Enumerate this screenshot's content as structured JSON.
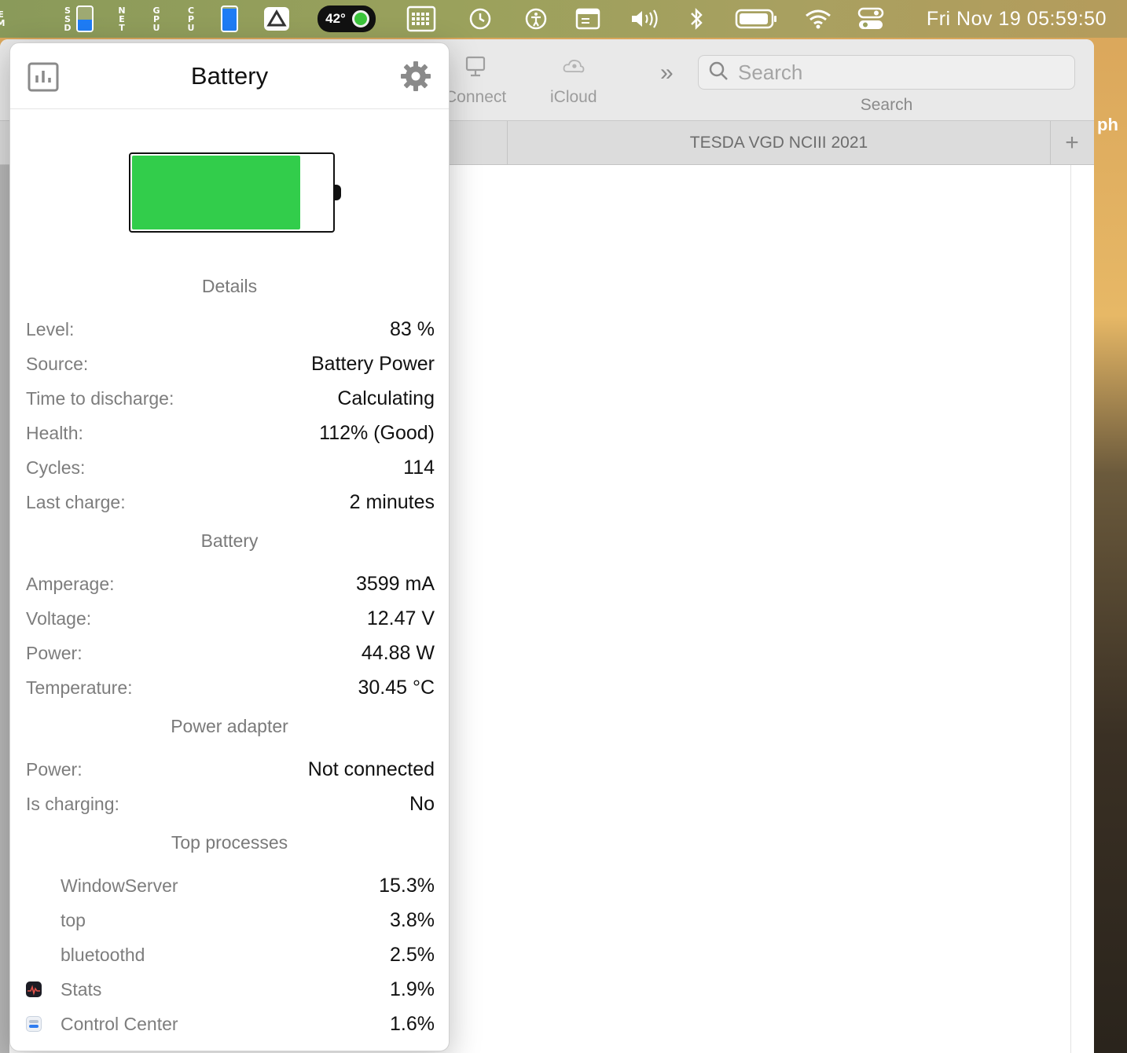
{
  "menubar": {
    "stack_labels": [
      {
        "name": "mem-stack",
        "text": "MEM"
      },
      {
        "name": "ssd-stack",
        "text": "SSD"
      },
      {
        "name": "net-stack",
        "text": "NET"
      },
      {
        "name": "gpu-stack",
        "text": "GPU"
      },
      {
        "name": "cpu-stack",
        "text": "CPU"
      }
    ],
    "temperature": "42°",
    "clock": "Fri Nov 19  05:59:50"
  },
  "window": {
    "toolbar": {
      "connect_label": "Connect",
      "icloud_label": "iCloud",
      "search_placeholder": "Search",
      "search_caption": "Search"
    },
    "tab_title": "TESDA VGD NCIII 2021",
    "right_label": "ph"
  },
  "popup": {
    "title": "Battery",
    "battery_level_fraction": 0.83,
    "battery_fill_color": "#32cd4b",
    "sections": {
      "details": "Details",
      "battery": "Battery",
      "power_adapter": "Power adapter",
      "top_processes": "Top processes"
    },
    "details": [
      {
        "label": "Level:",
        "value": "83 %"
      },
      {
        "label": "Source:",
        "value": "Battery Power"
      },
      {
        "label": "Time to discharge:",
        "value": "Calculating"
      },
      {
        "label": "Health:",
        "value": "112% (Good)"
      },
      {
        "label": "Cycles:",
        "value": "114"
      },
      {
        "label": "Last charge:",
        "value": "2 minutes"
      }
    ],
    "battery": [
      {
        "label": "Amperage:",
        "value": "3599 mA"
      },
      {
        "label": "Voltage:",
        "value": "12.47 V"
      },
      {
        "label": "Power:",
        "value": "44.88 W"
      },
      {
        "label": "Temperature:",
        "value": "30.45 °C"
      }
    ],
    "power_adapter": [
      {
        "label": "Power:",
        "value": "Not connected"
      },
      {
        "label": "Is charging:",
        "value": "No"
      }
    ],
    "processes": [
      {
        "name": "WindowServer",
        "value": "15.3%",
        "icon": ""
      },
      {
        "name": "top",
        "value": "3.8%",
        "icon": ""
      },
      {
        "name": "bluetoothd",
        "value": "2.5%",
        "icon": ""
      },
      {
        "name": "Stats",
        "value": "1.9%",
        "icon": "stats-app-icon"
      },
      {
        "name": "Control Center",
        "value": "1.6%",
        "icon": "control-center-app-icon"
      }
    ]
  }
}
